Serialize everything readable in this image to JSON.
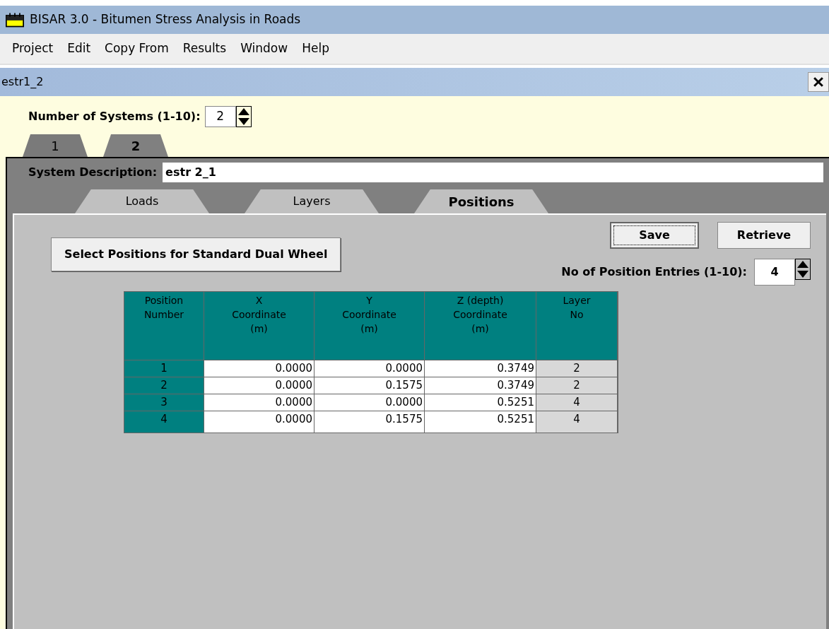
{
  "window": {
    "title": "BISAR 3.0 - Bitumen Stress Analysis in Roads"
  },
  "menu": [
    "Project",
    "Edit",
    "Copy From",
    "Results",
    "Window",
    "Help"
  ],
  "document": {
    "title": "estr1_2"
  },
  "systems_count": {
    "label": "Number of Systems (1-10):",
    "value": "2"
  },
  "system_tabs": [
    {
      "label": "1",
      "selected": false
    },
    {
      "label": "2",
      "selected": true
    }
  ],
  "system_description": {
    "label": "System Description:",
    "value": "estr 2_1"
  },
  "sub_tabs": [
    {
      "label": "Loads",
      "selected": false
    },
    {
      "label": "Layers",
      "selected": false
    },
    {
      "label": "Positions",
      "selected": true
    }
  ],
  "buttons": {
    "select": "Select Positions for Standard Dual Wheel",
    "save": "Save",
    "retrieve": "Retrieve"
  },
  "entries_count": {
    "label": "No of Position Entries (1-10):",
    "value": "4"
  },
  "table": {
    "columns": [
      "Position\nNumber",
      "X\nCoordinate\n(m)",
      "Y\nCoordinate\n(m)",
      "Z (depth)\nCoordinate\n(m)",
      "Layer\nNo"
    ],
    "rows": [
      [
        "1",
        "0.0000",
        "0.0000",
        "0.3749",
        "2"
      ],
      [
        "2",
        "0.0000",
        "0.1575",
        "0.3749",
        "2"
      ],
      [
        "3",
        "0.0000",
        "0.0000",
        "0.5251",
        "4"
      ],
      [
        "4",
        "0.0000",
        "0.1575",
        "0.5251",
        "4"
      ]
    ]
  }
}
